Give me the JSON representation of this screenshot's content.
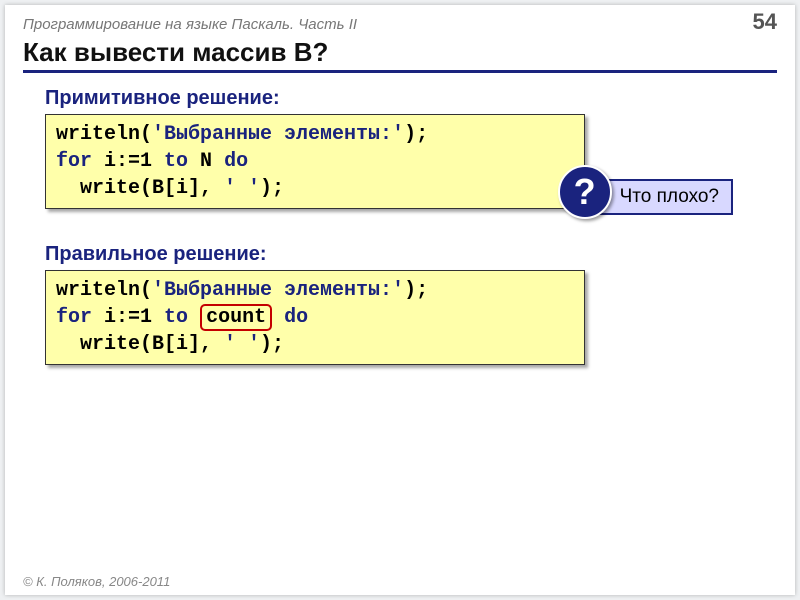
{
  "header": {
    "course": "Программирование на языке Паскаль. Часть II",
    "page": "54"
  },
  "title": "Как вывести массив B?",
  "section1": {
    "label": "Примитивное решение:",
    "line1a": "writeln(",
    "line1b": "'Выбранные элементы:'",
    "line1c": ");",
    "line2a": "for",
    "line2b": " i:=1 ",
    "line2c": "to",
    "line2d": " N ",
    "line2e": "do",
    "line3a": "  write(B[i], ",
    "line3b": "' '",
    "line3c": ");"
  },
  "callout": {
    "mark": "?",
    "text": "Что плохо?"
  },
  "section2": {
    "label": "Правильное решение:",
    "line1a": "writeln(",
    "line1b": "'Выбранные элементы:'",
    "line1c": ");",
    "line2a": "for",
    "line2b": " i:=1 ",
    "line2c": "to",
    "line2d_pre": " ",
    "line2d_hl": "count",
    "line2d_post": " ",
    "line2e": "do",
    "line3a": "  write(B[i], ",
    "line3b": "' '",
    "line3c": ");"
  },
  "footer": "© К. Поляков, 2006-2011"
}
